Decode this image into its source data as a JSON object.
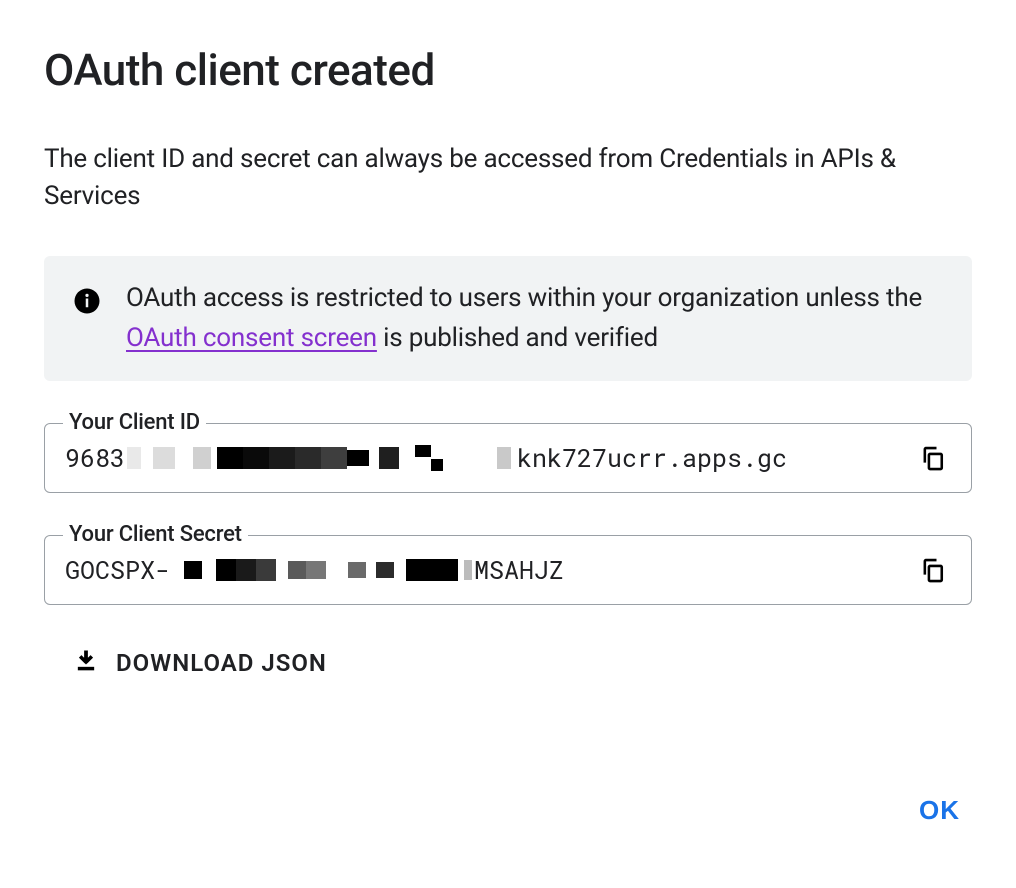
{
  "title": "OAuth client created",
  "description": "The client ID and secret can always be accessed from Credentials in APIs & Services",
  "banner": {
    "text_before": "OAuth access is restricted to users within your organization unless the ",
    "link_text": "OAuth consent screen",
    "text_after": " is published and verified"
  },
  "client_id": {
    "label": "Your Client ID",
    "value_prefix": "9683",
    "value_suffix": "knk727ucrr.apps.gc"
  },
  "client_secret": {
    "label": "Your Client Secret",
    "value_prefix": "GOCSPX-",
    "value_suffix": "MSAHJZ"
  },
  "download_label": "DOWNLOAD JSON",
  "ok_label": "OK"
}
